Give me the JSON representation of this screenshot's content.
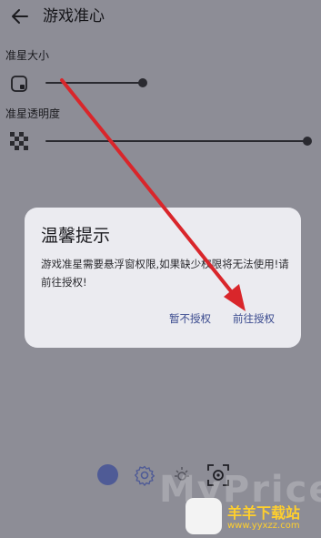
{
  "header": {
    "back_icon": "arrow-left-icon",
    "title": "游戏准心"
  },
  "settings": {
    "size": {
      "label": "准星大小",
      "icon": "crosshair-size-icon",
      "level": 0.37
    },
    "opacity": {
      "label": "准星透明度",
      "icon": "checkerboard-icon",
      "level": 1.0
    }
  },
  "dialog": {
    "title": "温馨提示",
    "message": "游戏准星需要悬浮窗权限,如果缺少权限将无法使用!请前往授权!",
    "cancel_label": "暂不授权",
    "confirm_label": "前往授权"
  },
  "bottom_bar": {
    "icons": [
      "color-dot-icon",
      "settings-icon",
      "brightness-icon",
      "crosshair-target-icon"
    ],
    "accent": "#4f5b96"
  },
  "annotation": {
    "arrow_color": "#d9262b"
  },
  "watermark": {
    "text": "MyPrice",
    "site_name": "羊羊下载站",
    "site_url": "www.yyxzz.com"
  }
}
